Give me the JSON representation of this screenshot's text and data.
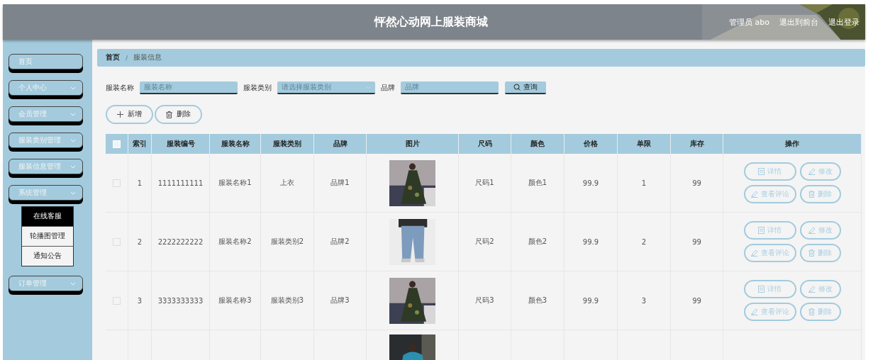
{
  "header": {
    "title": "怦然心动网上服装商城",
    "links": [
      "管理员 abo",
      "退出到前台",
      "退出登录"
    ]
  },
  "sidebar": {
    "items": [
      {
        "label": "首页",
        "has_children": false
      },
      {
        "label": "个人中心",
        "has_children": true
      },
      {
        "label": "会员管理",
        "has_children": true
      },
      {
        "label": "服装类别管理",
        "has_children": true
      },
      {
        "label": "服装信息管理",
        "has_children": true
      },
      {
        "label": "系统管理",
        "has_children": true,
        "children": [
          {
            "label": "在线客服",
            "selected": true
          },
          {
            "label": "轮播图管理",
            "selected": false
          },
          {
            "label": "通知公告",
            "selected": false
          }
        ]
      },
      {
        "label": "订单管理",
        "has_children": true
      }
    ]
  },
  "breadcrumb": {
    "separator": "/",
    "items": [
      "首页",
      "服装信息"
    ]
  },
  "search": {
    "fields": [
      {
        "label": "服装名称",
        "placeholder": "服装名称",
        "kind": "text"
      },
      {
        "label": "服装类别",
        "placeholder": "请选择服装类别",
        "kind": "select"
      },
      {
        "label": "品牌",
        "placeholder": "品牌",
        "kind": "text"
      }
    ],
    "button": "查询"
  },
  "toolbar": [
    {
      "label": "新增",
      "kind": "add"
    },
    {
      "label": "删除",
      "kind": "delete"
    }
  ],
  "table": {
    "header_checked": false,
    "columns": [
      "索引",
      "服装编号",
      "服装名称",
      "服装类别",
      "品牌",
      "图片",
      "尺码",
      "颜色",
      "价格",
      "单限",
      "库存",
      "操作"
    ],
    "rows": [
      {
        "kind": "full",
        "checked": false,
        "cells": [
          "1",
          "1111111111",
          "服装名称1",
          "上衣",
          "品牌1"
        ],
        "cells_after": [
          "尺码1",
          "颜色1",
          "99.9",
          "1",
          "99"
        ],
        "actions": [
          {
            "label": "详情",
            "kind": "detail"
          },
          {
            "label": "修改",
            "kind": "edit"
          },
          {
            "label": "查看评论",
            "kind": "edit"
          },
          {
            "label": "删除",
            "kind": "delete"
          }
        ]
      },
      {
        "kind": "full",
        "checked": false,
        "cells": [
          "2",
          "2222222222",
          "服装名称2",
          "服装类别2",
          "品牌2"
        ],
        "cells_after": [
          "尺码2",
          "颜色2",
          "99.9",
          "2",
          "99"
        ],
        "actions": [
          {
            "label": "详情",
            "kind": "detail"
          },
          {
            "label": "修改",
            "kind": "edit"
          },
          {
            "label": "查看评论",
            "kind": "edit"
          },
          {
            "label": "删除",
            "kind": "delete"
          }
        ]
      },
      {
        "kind": "full",
        "checked": false,
        "cells": [
          "3",
          "3333333333",
          "服装名称3",
          "服装类别3",
          "品牌3"
        ],
        "cells_after": [
          "尺码3",
          "颜色3",
          "99.9",
          "3",
          "99"
        ],
        "actions": [
          {
            "label": "详情",
            "kind": "detail"
          },
          {
            "label": "修改",
            "kind": "edit"
          },
          {
            "label": "查看评论",
            "kind": "edit"
          },
          {
            "label": "删除",
            "kind": "delete"
          }
        ]
      },
      {
        "kind": "cut"
      }
    ]
  }
}
